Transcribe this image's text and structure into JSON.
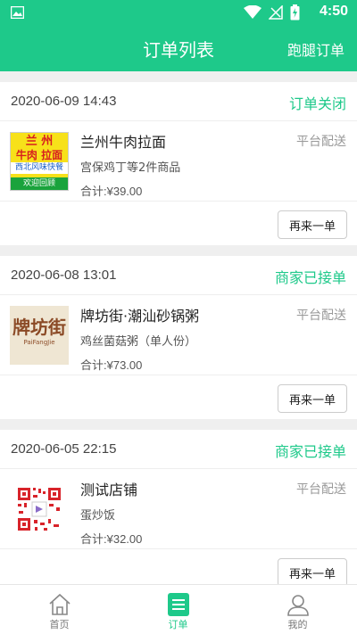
{
  "statusbar": {
    "time": "4:50"
  },
  "header": {
    "title": "订单列表",
    "right_action": "跑腿订单"
  },
  "orders": [
    {
      "date": "2020-06-09 14:43",
      "status": "订单关闭",
      "shop": "兰州牛肉拉面",
      "delivery": "平台配送",
      "items": "宫保鸡丁等2件商品",
      "total": "合计:¥39.00",
      "action": "再来一单",
      "thumb_text": [
        "兰 州",
        "牛肉 拉面",
        "西北风味快餐",
        "欢迎回顾"
      ]
    },
    {
      "date": "2020-06-08 13:01",
      "status": "商家已接单",
      "shop": "牌坊街·潮汕砂锅粥",
      "delivery": "平台配送",
      "items": "鸡丝菌菇粥（单人份）",
      "total": "合计:¥73.00",
      "action": "再来一单",
      "thumb_text": [
        "牌坊街",
        "PaiFangJie"
      ]
    },
    {
      "date": "2020-06-05 22:15",
      "status": "商家已接单",
      "shop": "测试店铺",
      "delivery": "平台配送",
      "items": "蛋炒饭",
      "total": "合计:¥32.00",
      "action": "再来一单",
      "thumb_text": []
    }
  ],
  "tabbar": {
    "tabs": [
      {
        "label": "首页",
        "icon": "home-icon"
      },
      {
        "label": "订单",
        "icon": "order-list-icon"
      },
      {
        "label": "我的",
        "icon": "user-icon"
      }
    ],
    "active_index": 1
  },
  "colors": {
    "accent": "#1ec98a"
  }
}
